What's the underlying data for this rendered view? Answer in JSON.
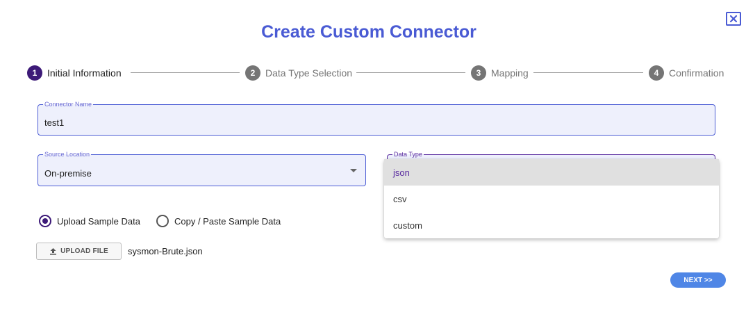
{
  "dialog": {
    "title": "Create Custom Connector",
    "close_icon": "close-icon"
  },
  "stepper": {
    "steps": [
      {
        "number": "1",
        "label": "Initial Information",
        "active": true
      },
      {
        "number": "2",
        "label": "Data Type Selection",
        "active": false
      },
      {
        "number": "3",
        "label": "Mapping",
        "active": false
      },
      {
        "number": "4",
        "label": "Confirmation",
        "active": false
      }
    ]
  },
  "form": {
    "connector_name": {
      "label": "Connector Name",
      "value": "test1"
    },
    "source_location": {
      "label": "Source Location",
      "value": "On-premise"
    },
    "data_type": {
      "label": "Data Type",
      "options": [
        "json",
        "csv",
        "custom"
      ],
      "highlighted": "json"
    },
    "sample_mode": {
      "options": [
        "Upload Sample Data",
        "Copy / Paste Sample Data"
      ],
      "selected": "Upload Sample Data"
    },
    "upload": {
      "button_label": "UPLOAD FILE",
      "icon": "upload-icon",
      "filename": "sysmon-Brute.json"
    }
  },
  "actions": {
    "next_label": "NEXT >>"
  },
  "colors": {
    "title": "#4a5bd4",
    "active_step": "#3d1a78",
    "inactive_step": "#757575",
    "field_bg": "#eef0fc",
    "next_button": "#4f86e6"
  }
}
